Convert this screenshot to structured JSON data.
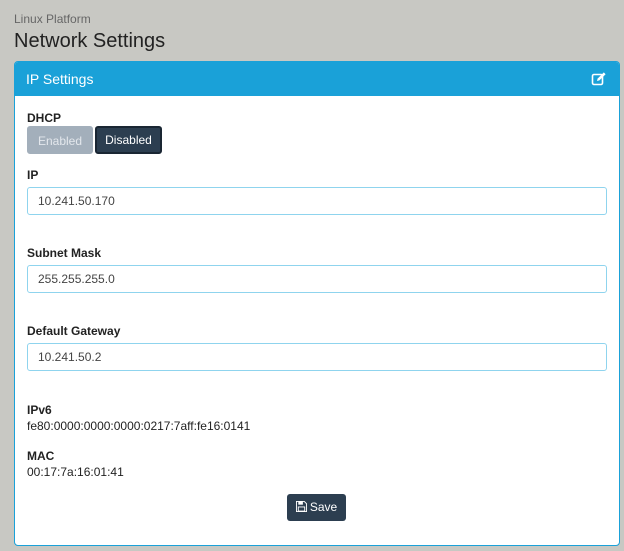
{
  "header": {
    "platform": "Linux Platform",
    "title": "Network Settings"
  },
  "panel": {
    "title": "IP Settings",
    "edit_icon": "edit-icon"
  },
  "dhcp": {
    "label": "DHCP",
    "options": [
      "Enabled",
      "Disabled"
    ],
    "selected": "Disabled"
  },
  "ip": {
    "label": "IP",
    "value": "10.241.50.170"
  },
  "subnet": {
    "label": "Subnet Mask",
    "value": "255.255.255.0"
  },
  "gateway": {
    "label": "Default Gateway",
    "value": "10.241.50.2"
  },
  "ipv6": {
    "label": "IPv6",
    "value": "fe80:0000:0000:0000:0217:7aff:fe16:0141"
  },
  "mac": {
    "label": "MAC",
    "value": "00:17:7a:16:01:41"
  },
  "save": {
    "label": "Save",
    "icon": "floppy-disk-icon"
  },
  "colors": {
    "accent": "#1aa1d8",
    "button_dark": "#2c3e50",
    "button_inactive": "#a3afbb",
    "background": "#c8c8c3"
  }
}
